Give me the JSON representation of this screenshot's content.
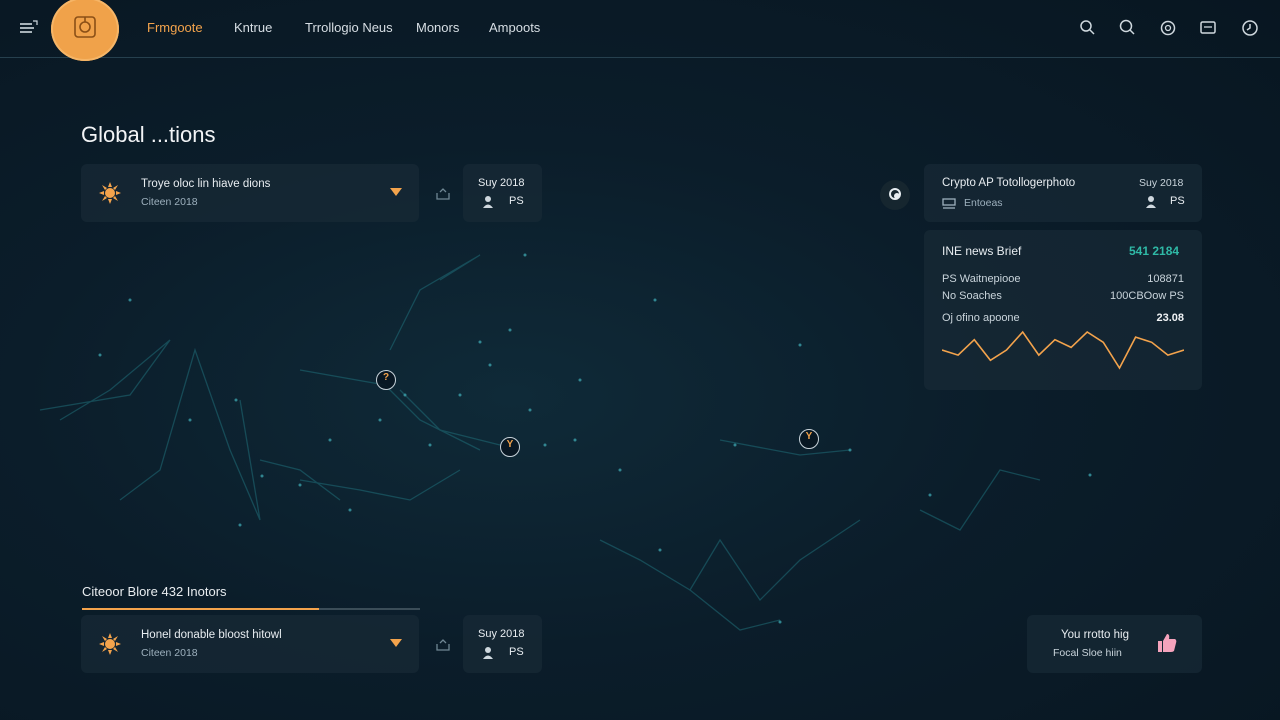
{
  "topbar": {
    "nav": [
      "Frmgoote",
      "Kntrue",
      "Trrollogio Neus",
      "Monors",
      "Ampoots"
    ],
    "active_index": 0,
    "icons": [
      "menu-icon",
      "search-icon",
      "search-icon",
      "at-icon",
      "message-icon",
      "clock-icon"
    ]
  },
  "page": {
    "title": "Global ...tions"
  },
  "card1": {
    "title": "Troye oloc lin hiave dions",
    "subtitle": "Citeen 2018",
    "date": "Suy 2018",
    "code": "PS"
  },
  "crypto": {
    "title": "Crypto AP Totollogerphoto",
    "date": "Suy 2018",
    "subtitle": "Entoeas",
    "code": "PS"
  },
  "brief": {
    "title": "INE news Brief",
    "value": "541 2184",
    "rows": [
      {
        "label": "PS Waitnepiooe",
        "value": "108871"
      },
      {
        "label": "No Soaches",
        "value": "100CBOow PS"
      },
      {
        "label": "Oj ofino apoone",
        "value": "23.08"
      }
    ],
    "sparkline": [
      44,
      40,
      52,
      36,
      44,
      58,
      40,
      52,
      46,
      58,
      50,
      30,
      54,
      50,
      40,
      44
    ]
  },
  "section": {
    "title": "Citeoor Blore 432 Inotors",
    "progress": 0.7
  },
  "card2": {
    "title": "Honel donable bloost hitowl",
    "subtitle": "Citeen 2018",
    "date": "Suy 2018",
    "code": "PS"
  },
  "promo": {
    "title": "You rrotto hig",
    "subtitle": "Focal Sloe hiin"
  },
  "colors": {
    "accent": "#f3a34c",
    "teal": "#2fb9a6",
    "bg": "#0b1d2a"
  }
}
